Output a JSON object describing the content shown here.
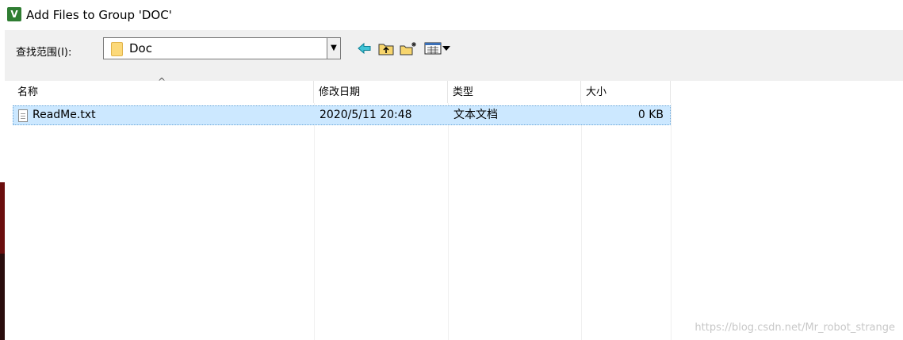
{
  "window": {
    "title": "Add Files to Group 'DOC'",
    "app_icon_glyph": "V",
    "icon": "keil-uvision-icon"
  },
  "toolbar": {
    "lookin_label": "查找范围(I):",
    "location_value": "Doc",
    "buttons": [
      {
        "icon": "back-arrow-icon"
      },
      {
        "icon": "up-folder-icon"
      },
      {
        "icon": "new-folder-icon"
      },
      {
        "icon": "view-menu-icon"
      }
    ]
  },
  "list": {
    "columns": [
      "名称",
      "修改日期",
      "类型",
      "大小"
    ],
    "rows": [
      {
        "name": "ReadMe.txt",
        "modified": "2020/5/11 20:48",
        "type": "文本文档",
        "size": "0 KB",
        "selected": true
      }
    ]
  },
  "watermark": "https://blog.csdn.net/Mr_robot_strange",
  "colors": {
    "selection": "#cce8ff",
    "toolbar_bg": "#f0f0f0",
    "folder": "#fcd97a"
  }
}
